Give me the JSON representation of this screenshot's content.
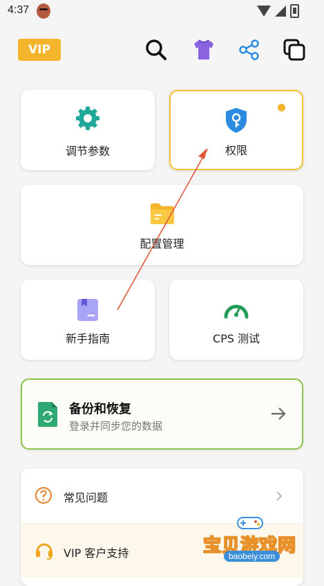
{
  "status_bar": {
    "time": "4:37"
  },
  "topbar": {
    "vip_label": "VIP"
  },
  "grid": {
    "params_label": "调节参数",
    "permissions_label": "权限",
    "config_label": "配置管理",
    "guide_label": "新手指南",
    "cps_label": "CPS 测试"
  },
  "backup": {
    "title": "备份和恢复",
    "subtitle": "登录并同步您的数据"
  },
  "list": {
    "faq_label": "常见问题",
    "support_label": "VIP 客户支持"
  },
  "watermark": {
    "text": "宝贝游戏网",
    "url": "baobeiy.com"
  },
  "colors": {
    "accent": "#f4b42b",
    "teal": "#20a89a",
    "blue": "#2a8be0",
    "green": "#8bc34a",
    "arrow": "#e05a3a"
  }
}
